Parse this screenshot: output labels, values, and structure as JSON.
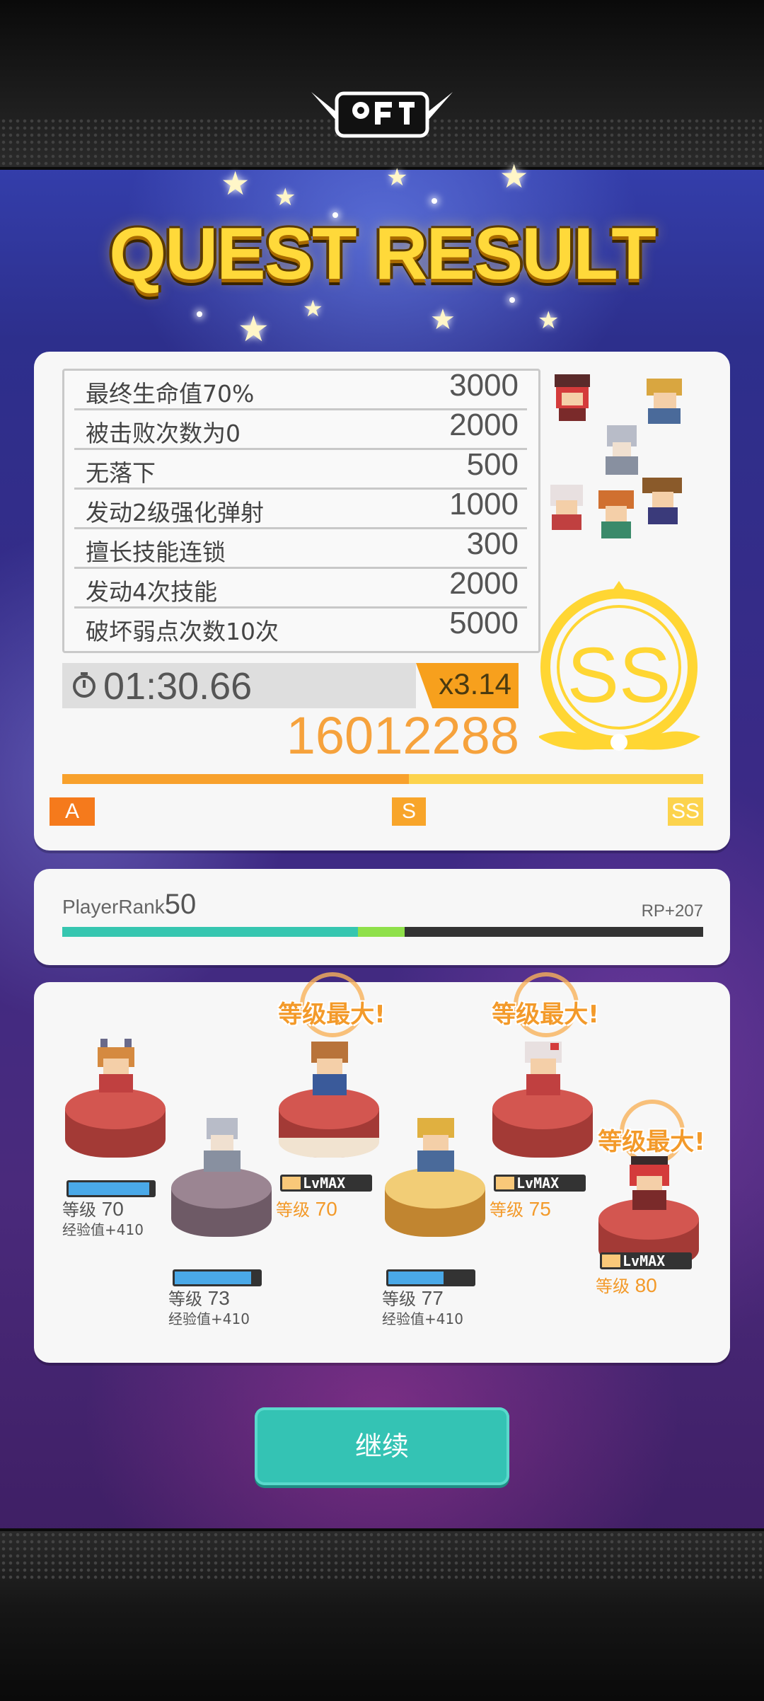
{
  "header": {
    "title": "QUEST RESULT"
  },
  "bonuses": [
    {
      "label": "最终生命值70%",
      "points": "3000"
    },
    {
      "label": "被击败次数为0",
      "points": "2000"
    },
    {
      "label": "无落下",
      "points": "500"
    },
    {
      "label": "发动2级强化弹射",
      "points": "1000"
    },
    {
      "label": "擅长技能连锁",
      "points": "300"
    },
    {
      "label": "发动4次技能",
      "points": "2000"
    },
    {
      "label": "破坏弱点次数10次",
      "points": "5000"
    }
  ],
  "result": {
    "time": "01:30.66",
    "multiplier": "x3.14",
    "score": "16012288",
    "rank": "SS",
    "rank_marks": [
      "A",
      "S",
      "SS"
    ],
    "rank_progress": 1.0
  },
  "player": {
    "label": "PlayerRank",
    "rank": "50",
    "rp": "RP+207",
    "progress_before": 0.46,
    "progress_gained": 0.07
  },
  "units": [
    {
      "level_label": "等级",
      "level": "70",
      "exp": "经验值+410",
      "xp_fill": 0.95,
      "max": false,
      "pedestal": "#c1443e"
    },
    {
      "level_label": "等级",
      "level": "73",
      "exp": "经验值+410",
      "xp_fill": 0.9,
      "max": false,
      "pedestal": "#8a7080"
    },
    {
      "level_label": "等级",
      "level": "70",
      "lvmax": "LvMAX",
      "max": true,
      "max_text": "等级最大!",
      "pedestal": "#c1443e"
    },
    {
      "level_label": "等级",
      "level": "77",
      "exp": "经验值+410",
      "xp_fill": 0.65,
      "max": false,
      "pedestal": "#e6b24e"
    },
    {
      "level_label": "等级",
      "level": "75",
      "lvmax": "LvMAX",
      "max": true,
      "max_text": "等级最大!",
      "pedestal": "#c1443e"
    },
    {
      "level_label": "等级",
      "level": "80",
      "lvmax": "LvMAX",
      "max": true,
      "max_text": "等级最大!",
      "pedestal": "#c1443e"
    }
  ],
  "continue_label": "继续",
  "colors": {
    "accent": "#f6a23c",
    "teal": "#34c3b4",
    "gold": "#ffd633"
  }
}
